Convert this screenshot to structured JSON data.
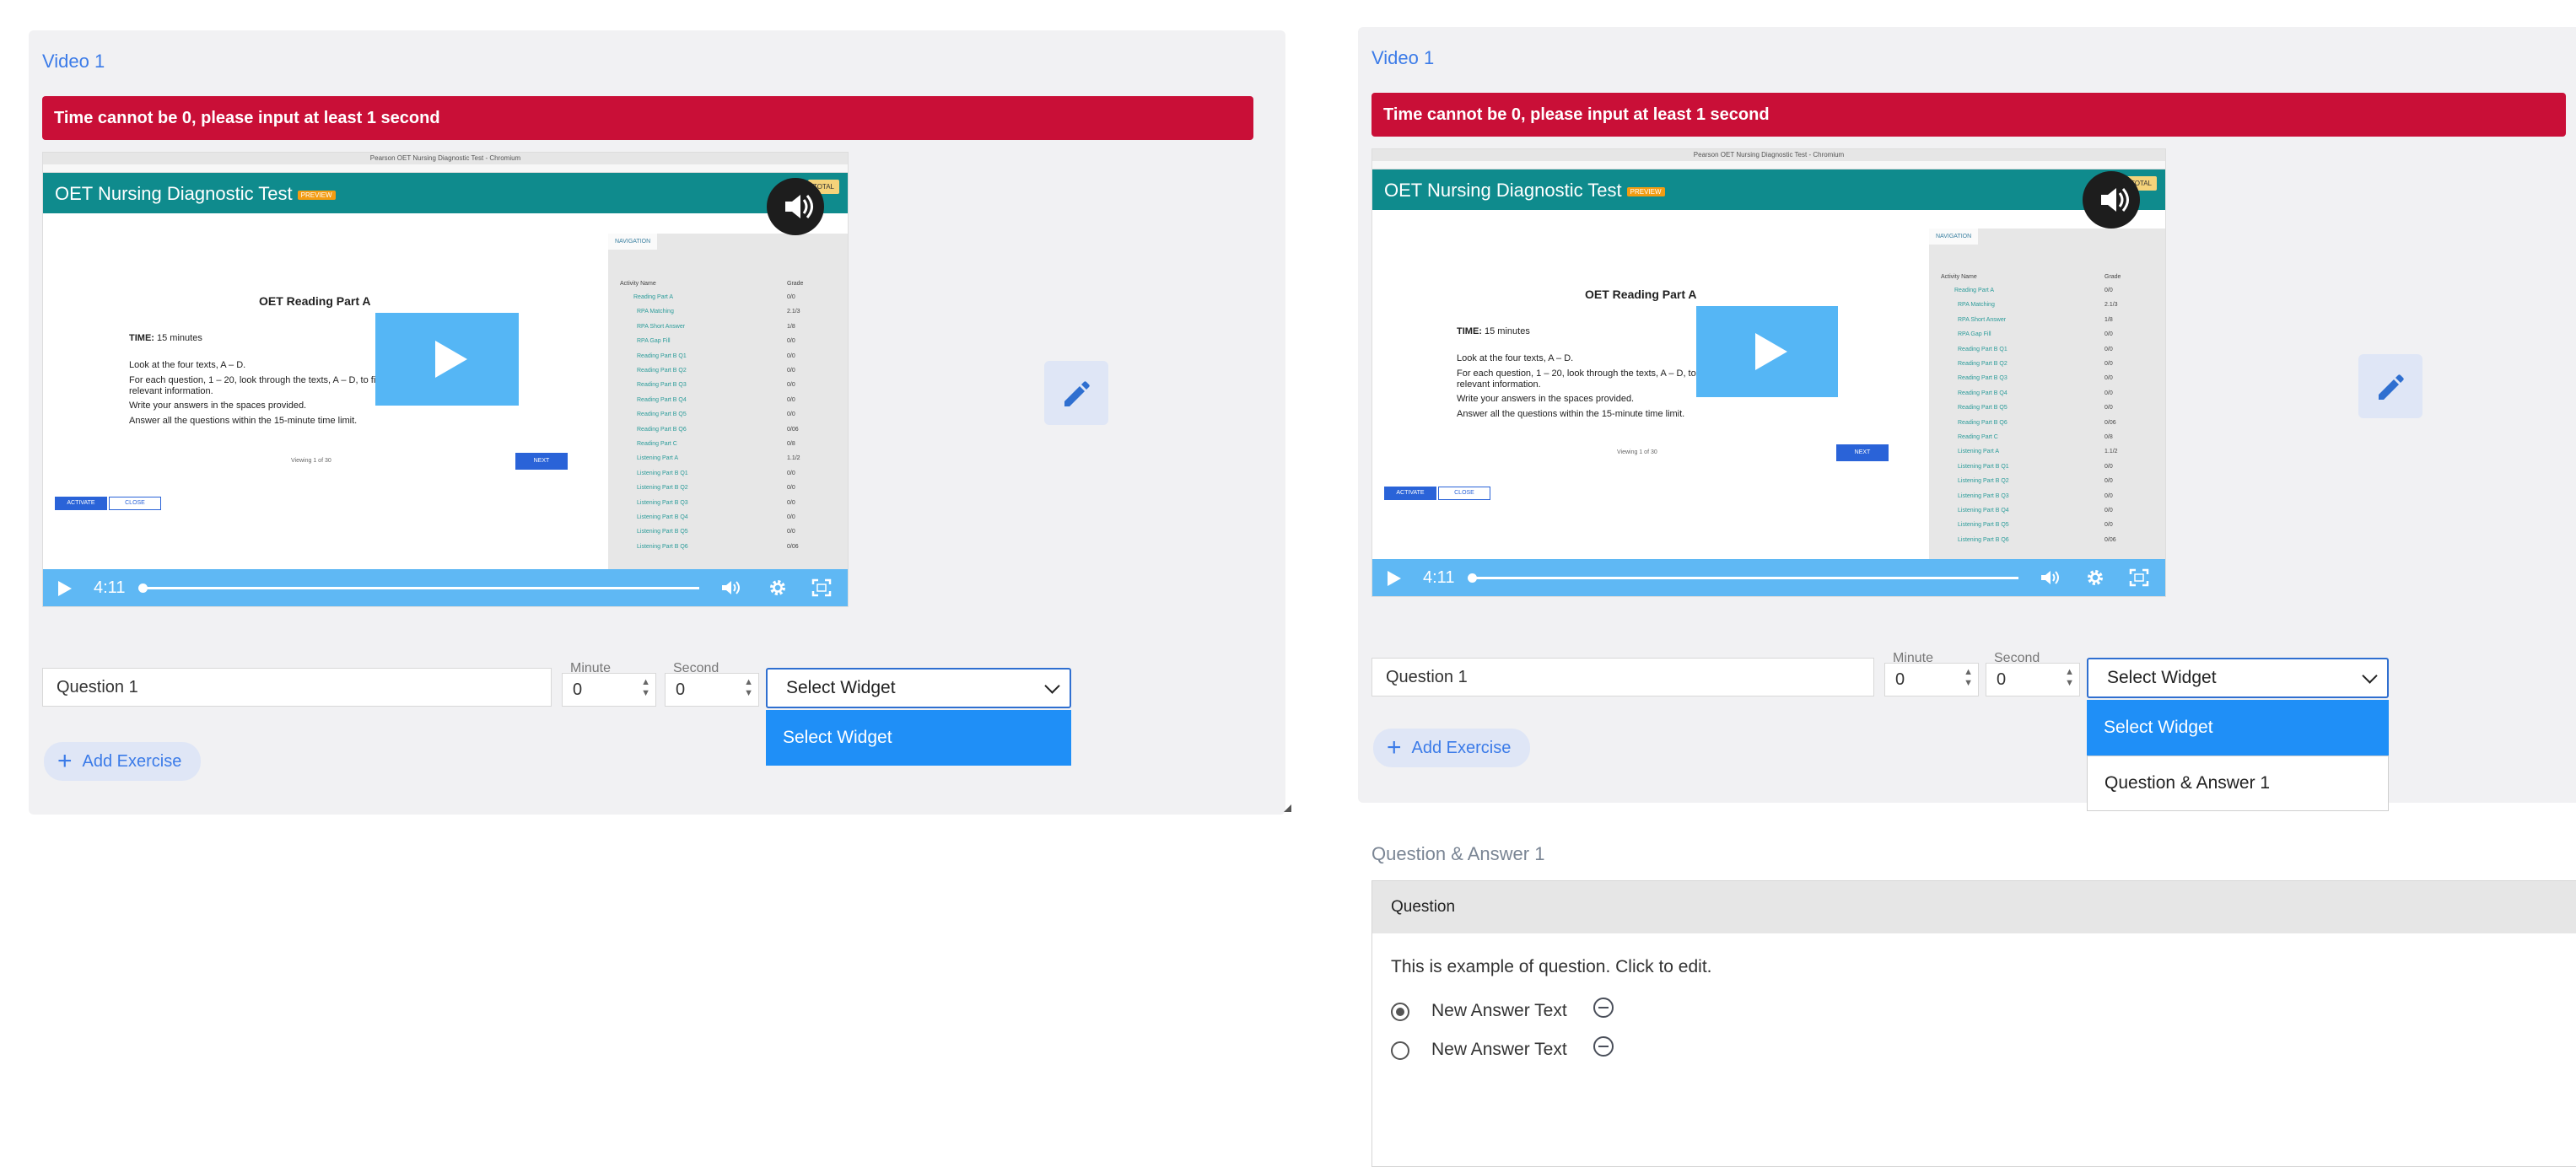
{
  "colors": {
    "accent": "#3b7be8",
    "error": "#c90f37",
    "select_highlight": "#1f8ff7",
    "video_controls": "#5fb8f4",
    "video_header": "#0f8b8d"
  },
  "left": {
    "title": "Video 1",
    "error": "Time cannot be 0, please input at least 1 second",
    "video": {
      "browser_title": "Pearson OET Nursing Diagnostic Test - Chromium",
      "header_title": "OET Nursing Diagnostic Test",
      "badge": "PREVIEW",
      "total": "TOTAL",
      "doc_title": "OET Reading Part A",
      "time_label": "TIME:",
      "time_value": "15 minutes",
      "line1": "Look at the four texts, A – D.",
      "line2": "For each question, 1 – 20, look through the texts, A – D, to find the relevant information.",
      "line3": "Write your answers in the spaces provided.",
      "line4": "Answer all the questions within the 15-minute time limit.",
      "viewing": "Viewing 1 of 30",
      "next": "NEXT",
      "activate": "ACTIVATE",
      "close": "CLOSE",
      "nav_tab": "NAVIGATION",
      "nav_col1": "Activity Name",
      "nav_col2": "Grade",
      "time": "4:11",
      "progress": 0.0
    },
    "question_value": "Question 1",
    "minute_label": "Minute",
    "minute_value": "0",
    "second_label": "Second",
    "second_value": "0",
    "select_value": "Select Widget",
    "options": [
      "Select Widget"
    ],
    "add_exercise": "Add Exercise"
  },
  "right": {
    "title": "Video 1",
    "error": "Time cannot be 0, please input at least 1 second",
    "video": {
      "browser_title": "Pearson OET Nursing Diagnostic Test - Chromium",
      "header_title": "OET Nursing Diagnostic Test",
      "badge": "PREVIEW",
      "total": "TOTAL",
      "doc_title": "OET Reading Part A",
      "time_label": "TIME:",
      "time_value": "15 minutes",
      "line1": "Look at the four texts, A – D.",
      "line2": "For each question, 1 – 20, look through the texts, A – D, to find the relevant information.",
      "line3": "Write your answers in the spaces provided.",
      "line4": "Answer all the questions within the 15-minute time limit.",
      "viewing": "Viewing 1 of 30",
      "next": "NEXT",
      "activate": "ACTIVATE",
      "close": "CLOSE",
      "nav_tab": "NAVIGATION",
      "nav_col1": "Activity Name",
      "nav_col2": "Grade",
      "time": "4:11",
      "progress": 0.0
    },
    "question_value": "Question 1",
    "minute_label": "Minute",
    "minute_value": "0",
    "second_label": "Second",
    "second_value": "0",
    "select_value": "Select Widget",
    "options": [
      "Select Widget",
      "Question & Answer 1"
    ],
    "add_exercise": "Add Exercise",
    "qa": {
      "title": "Question & Answer 1",
      "header": "Question",
      "question_text": "This is example of question. Click to edit.",
      "answers": [
        {
          "text": "New Answer Text",
          "selected": true
        },
        {
          "text": "New Answer Text",
          "selected": false
        }
      ]
    }
  },
  "nav_rows": [
    {
      "name": "Reading Part A",
      "grade": "0/0"
    },
    {
      "name": "RPA Matching",
      "grade": "2.1/3"
    },
    {
      "name": "RPA Short Answer",
      "grade": "1/8"
    },
    {
      "name": "RPA Gap Fill",
      "grade": "0/0"
    },
    {
      "name": "Reading Part B Q1",
      "grade": "0/0"
    },
    {
      "name": "Reading Part B Q2",
      "grade": "0/0"
    },
    {
      "name": "Reading Part B Q3",
      "grade": "0/0"
    },
    {
      "name": "Reading Part B Q4",
      "grade": "0/0"
    },
    {
      "name": "Reading Part B Q5",
      "grade": "0/0"
    },
    {
      "name": "Reading Part B Q6",
      "grade": "0/06"
    },
    {
      "name": "Reading Part C",
      "grade": "0/8"
    },
    {
      "name": "Listening Part A",
      "grade": "1.1/2"
    },
    {
      "name": "Listening Part B Q1",
      "grade": "0/0"
    },
    {
      "name": "Listening Part B Q2",
      "grade": "0/0"
    },
    {
      "name": "Listening Part B Q3",
      "grade": "0/0"
    },
    {
      "name": "Listening Part B Q4",
      "grade": "0/0"
    },
    {
      "name": "Listening Part B Q5",
      "grade": "0/0"
    },
    {
      "name": "Listening Part B Q6",
      "grade": "0/06"
    }
  ]
}
